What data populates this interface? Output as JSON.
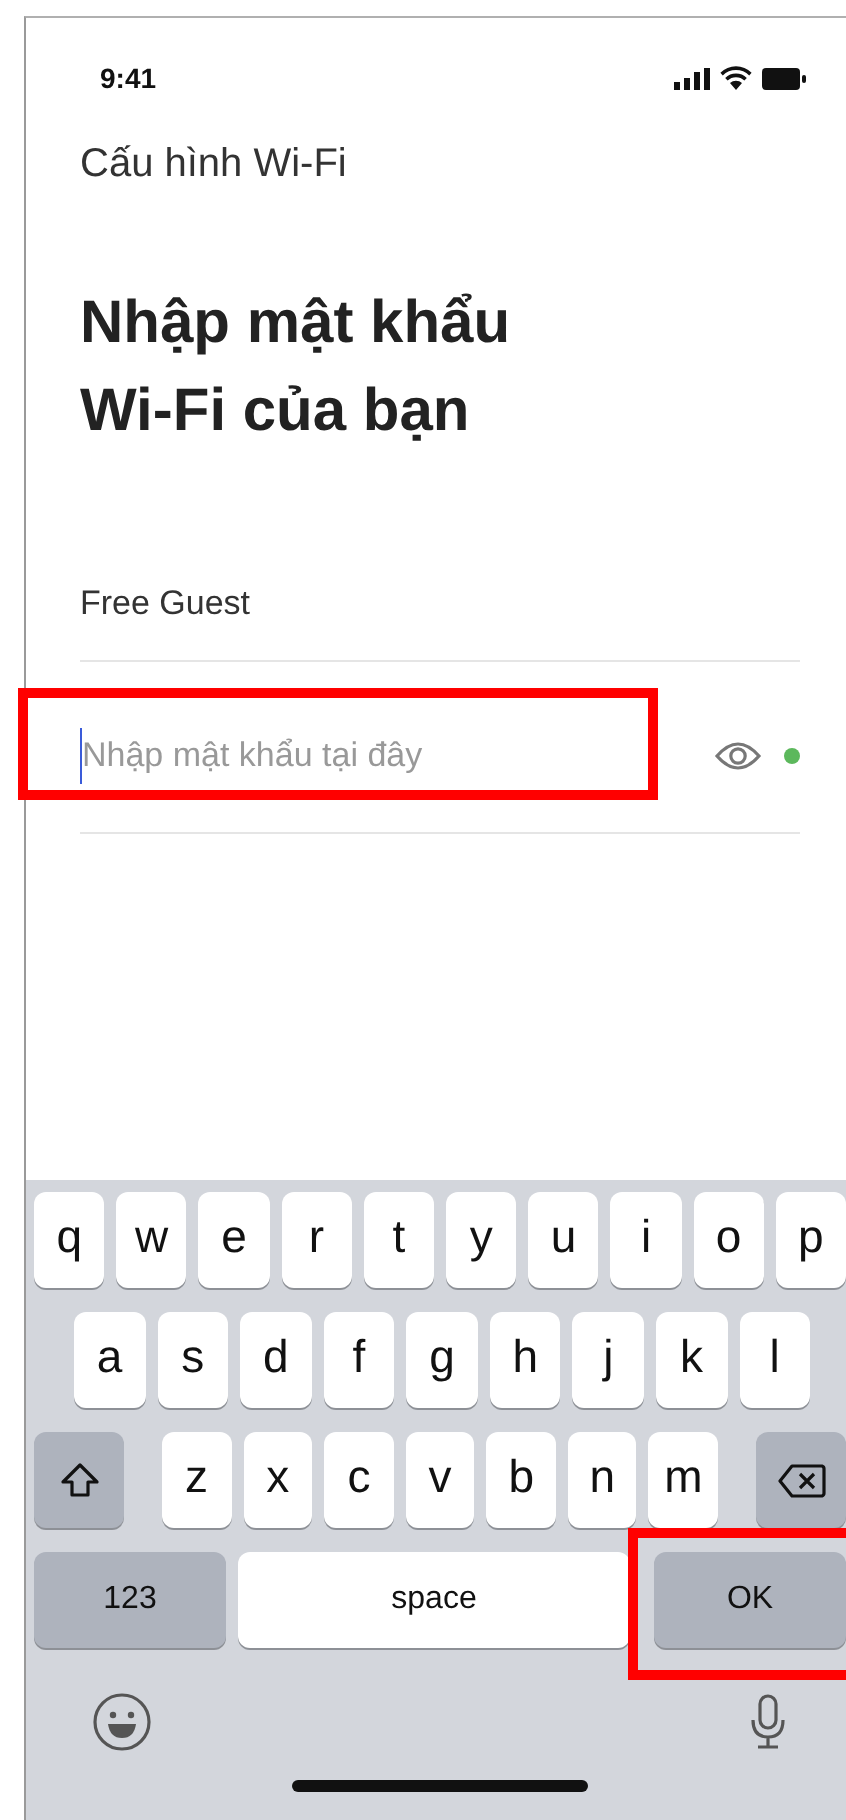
{
  "status_bar": {
    "time": "9:41"
  },
  "nav_title": "Cấu hình Wi-Fi",
  "heading_lines": [
    "Nhập mật khẩu",
    "Wi-Fi của bạn"
  ],
  "network": "Free Guest",
  "password": {
    "placeholder": "Nhập mật khẩu tại đây",
    "highlighted": true
  },
  "keyboard": {
    "rows": [
      [
        {
          "kind": "letter",
          "label": "q"
        },
        {
          "kind": "letter",
          "label": "w"
        },
        {
          "kind": "letter",
          "label": "e"
        },
        {
          "kind": "letter",
          "label": "r"
        },
        {
          "kind": "letter",
          "label": "t"
        },
        {
          "kind": "letter",
          "label": "y"
        },
        {
          "kind": "letter",
          "label": "u"
        },
        {
          "kind": "letter",
          "label": "i"
        },
        {
          "kind": "letter",
          "label": "o"
        },
        {
          "kind": "letter",
          "label": "p"
        }
      ],
      [
        {
          "kind": "letter",
          "label": "a"
        },
        {
          "kind": "letter",
          "label": "s"
        },
        {
          "kind": "letter",
          "label": "d"
        },
        {
          "kind": "letter",
          "label": "f"
        },
        {
          "kind": "letter",
          "label": "g"
        },
        {
          "kind": "letter",
          "label": "h"
        },
        {
          "kind": "letter",
          "label": "j"
        },
        {
          "kind": "letter",
          "label": "k"
        },
        {
          "kind": "letter",
          "label": "l"
        }
      ],
      [
        {
          "kind": "shift"
        },
        {
          "kind": "letter",
          "label": "z"
        },
        {
          "kind": "letter",
          "label": "x"
        },
        {
          "kind": "letter",
          "label": "c"
        },
        {
          "kind": "letter",
          "label": "v"
        },
        {
          "kind": "letter",
          "label": "b"
        },
        {
          "kind": "letter",
          "label": "n"
        },
        {
          "kind": "letter",
          "label": "m"
        },
        {
          "kind": "backspace"
        }
      ]
    ],
    "bottom_row": [
      {
        "kind": "mode",
        "label": "123"
      },
      {
        "kind": "space",
        "label": "space"
      },
      {
        "kind": "action",
        "label": "OK",
        "highlighted": true
      }
    ]
  }
}
